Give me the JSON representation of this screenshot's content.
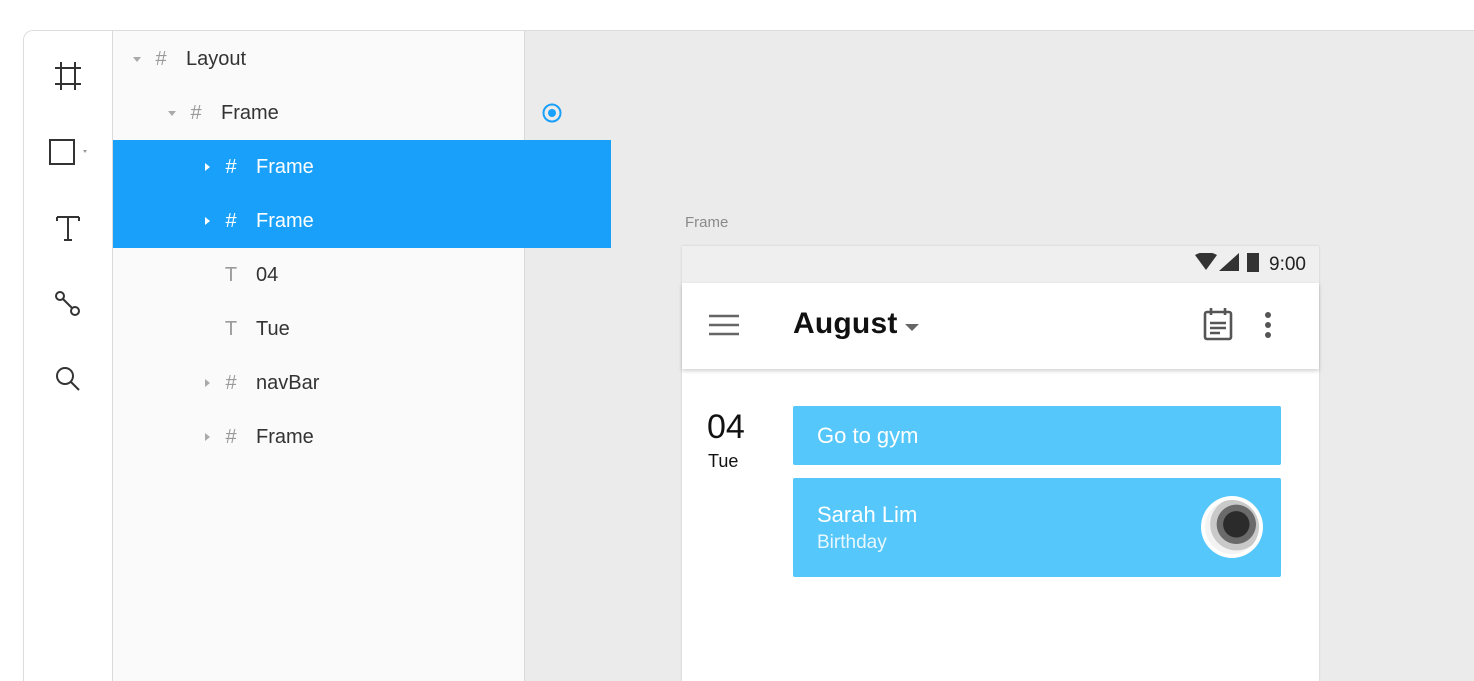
{
  "toolbar": {
    "tools": [
      "frame-tool",
      "rectangle-tool",
      "text-tool",
      "pen-tool",
      "search-tool"
    ]
  },
  "layers": {
    "items": [
      {
        "label": "Layout",
        "type": "frame",
        "expanded": true,
        "selected": false
      },
      {
        "label": "Frame",
        "type": "frame",
        "expanded": true,
        "selected": false
      },
      {
        "label": "Frame",
        "type": "frame",
        "expanded": false,
        "selected": true
      },
      {
        "label": "Frame",
        "type": "frame",
        "expanded": false,
        "selected": true
      },
      {
        "label": "04",
        "type": "text",
        "selected": false
      },
      {
        "label": "Tue",
        "type": "text",
        "selected": false
      },
      {
        "label": "navBar",
        "type": "frame",
        "expanded": false,
        "selected": false
      },
      {
        "label": "Frame",
        "type": "frame",
        "expanded": false,
        "selected": false
      }
    ]
  },
  "canvas": {
    "frame_label": "Frame",
    "phone": {
      "status_time": "9:00",
      "app_bar": {
        "month": "August"
      },
      "day": {
        "number": "04",
        "name": "Tue"
      },
      "events": [
        {
          "title": "Go to gym"
        },
        {
          "title": "Sarah Lim",
          "subtitle": "Birthday"
        }
      ]
    }
  },
  "colors": {
    "selection": "#18a0fb",
    "event_card": "#55c7fa",
    "canvas_bg": "#ebebeb"
  }
}
